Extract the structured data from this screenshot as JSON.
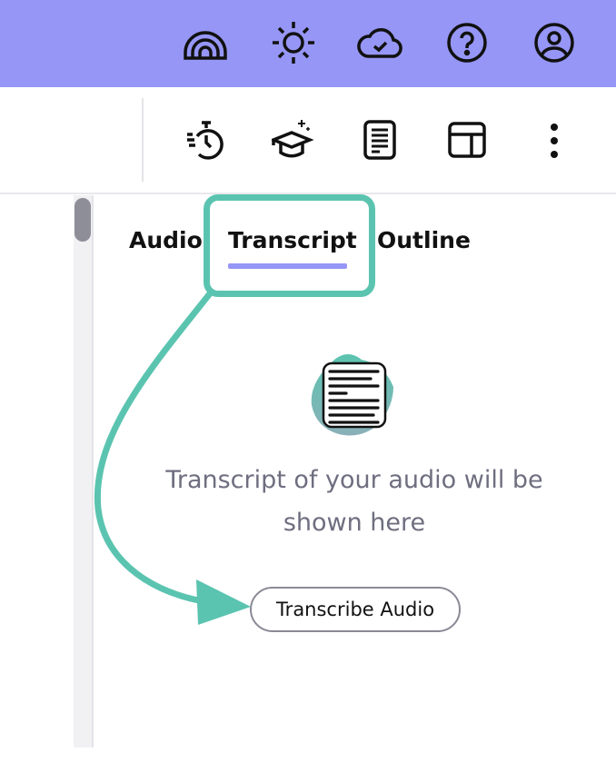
{
  "topbar": {
    "icons": [
      "rainbow-icon",
      "sun-icon",
      "cloud-check-icon",
      "help-icon",
      "user-icon"
    ],
    "bg": "#9696f6"
  },
  "toolbar": {
    "icons": [
      "speed-timer-icon",
      "graduation-cap-sparkle-icon",
      "document-icon",
      "layout-icon",
      "more-vertical-icon"
    ]
  },
  "tabs": {
    "audio": "Audio",
    "transcript": "Transcript",
    "outline": "Outline",
    "active": "Transcript"
  },
  "empty_state": {
    "message": "Transcript of your audio will be shown here",
    "button": "Transcribe Audio"
  },
  "accent": "#5bc4b0"
}
